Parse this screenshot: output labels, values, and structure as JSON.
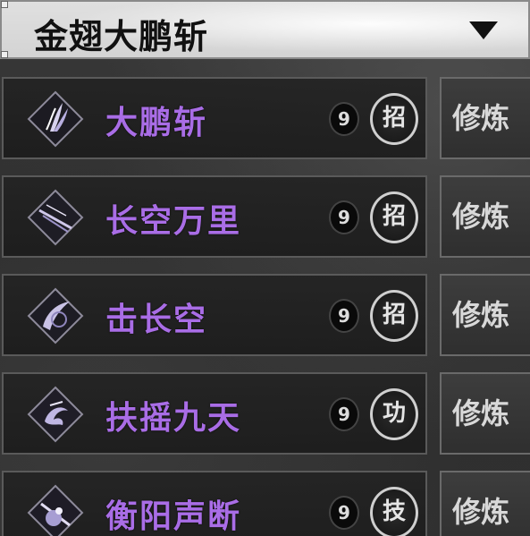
{
  "header": {
    "title": "金翅大鹏斩",
    "arrow_icon": "chevron-down-icon"
  },
  "colors": {
    "skill_name": "#a96de6",
    "panel_bg": "#222222",
    "badge_ring": "#cfcfcf"
  },
  "skills": [
    {
      "name": "大鹏斩",
      "level": "9",
      "type": "招",
      "action": "修炼",
      "icon": "feather-slash-icon"
    },
    {
      "name": "长空万里",
      "level": "9",
      "type": "招",
      "action": "修炼",
      "icon": "sky-streak-icon"
    },
    {
      "name": "击长空",
      "level": "9",
      "type": "招",
      "action": "修炼",
      "icon": "crescent-strike-icon"
    },
    {
      "name": "扶摇九天",
      "level": "9",
      "type": "功",
      "action": "修炼",
      "icon": "whirlwind-icon"
    },
    {
      "name": "衡阳声断",
      "level": "9",
      "type": "技",
      "action": "修炼",
      "icon": "sound-break-icon"
    }
  ]
}
